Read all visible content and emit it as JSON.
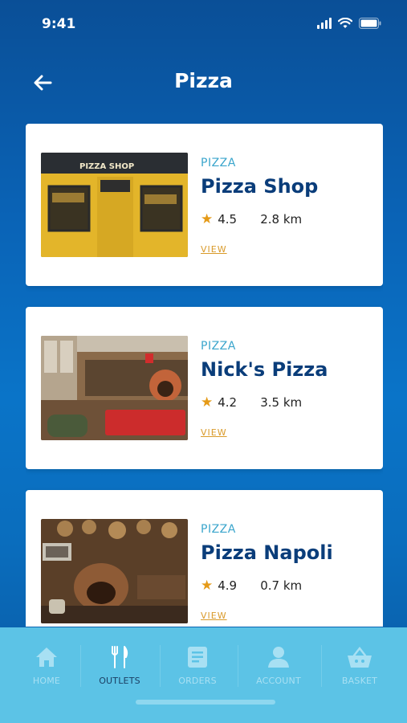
{
  "status": {
    "time": "9:41"
  },
  "header": {
    "title": "Pizza"
  },
  "outlets": [
    {
      "category": "PIZZA",
      "name": "Pizza Shop",
      "rating": "4.5",
      "distance": "2.8 km",
      "view_label": "VIEW",
      "sign_text": "PIZZA SHOP"
    },
    {
      "category": "PIZZA",
      "name": "Nick's Pizza",
      "rating": "4.2",
      "distance": "3.5 km",
      "view_label": "VIEW"
    },
    {
      "category": "PIZZA",
      "name": "Pizza Napoli",
      "rating": "4.9",
      "distance": "0.7 km",
      "view_label": "VIEW"
    }
  ],
  "tabbar": {
    "tabs": [
      {
        "label": "HOME",
        "icon": "home-icon"
      },
      {
        "label": "OUTLETS",
        "icon": "cutlery-icon",
        "active": true
      },
      {
        "label": "ORDERS",
        "icon": "orders-icon"
      },
      {
        "label": "ACCOUNT",
        "icon": "account-icon"
      },
      {
        "label": "BASKET",
        "icon": "basket-icon"
      }
    ]
  },
  "colors": {
    "accent_dark": "#0a3d7a",
    "category": "#3aa5cc",
    "star": "#e59a17",
    "view_link": "#d99a2a",
    "tabbar_bg": "#5cc3e6",
    "tab_active": "#1b3f63",
    "tab_inactive": "#a8e0f3"
  }
}
